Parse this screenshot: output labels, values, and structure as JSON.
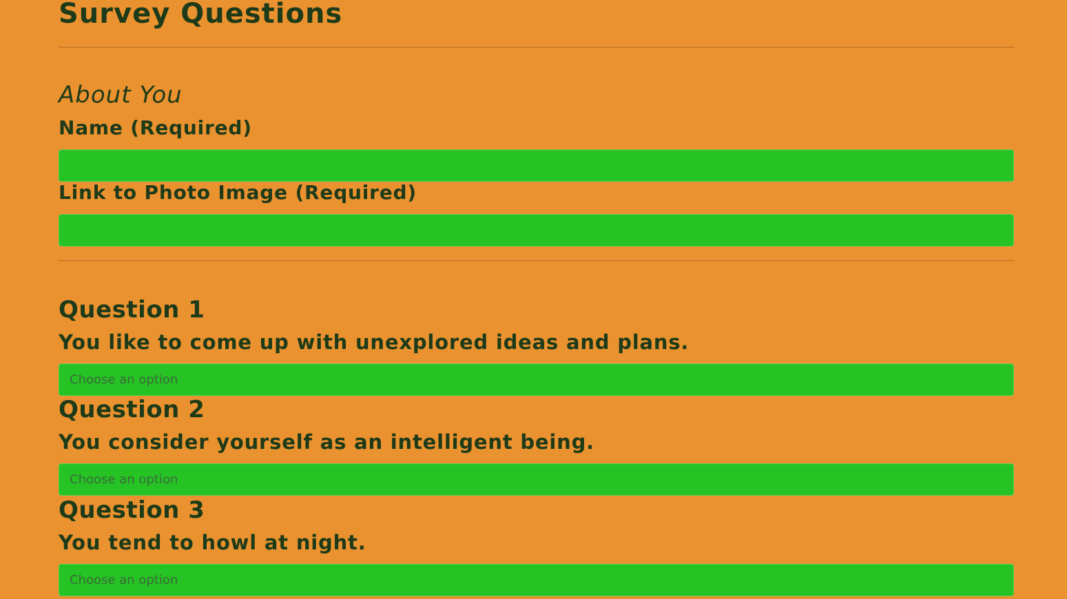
{
  "page": {
    "title": "Survey Questions"
  },
  "about": {
    "title": "About You",
    "name_label": "Name (Required)",
    "name_value": "",
    "photo_label": "Link to Photo Image (Required)",
    "photo_value": ""
  },
  "questions": [
    {
      "title": "Question 1",
      "text": "You like to come up with unexplored ideas and plans.",
      "selected": "Choose an option"
    },
    {
      "title": "Question 2",
      "text": "You consider yourself as an intelligent being.",
      "selected": "Choose an option"
    },
    {
      "title": "Question 3",
      "text": "You tend to howl at night.",
      "selected": "Choose an option"
    }
  ],
  "colors": {
    "background": "#ea922f",
    "field": "#26c324",
    "text": "#1d3a19"
  }
}
